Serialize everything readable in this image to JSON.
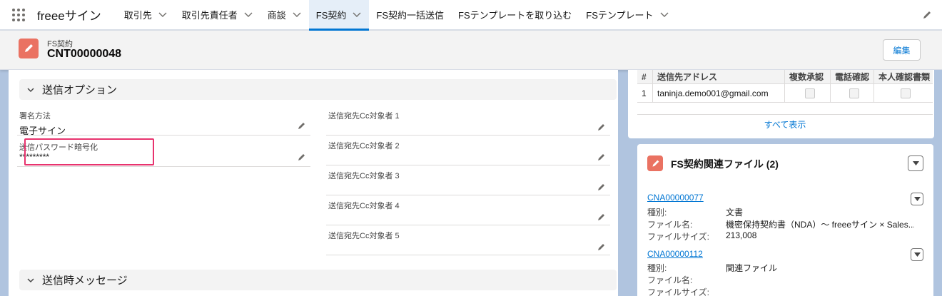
{
  "app": {
    "name": "freeeサイン"
  },
  "nav": {
    "tabs": [
      {
        "label": "取引先",
        "dropdown": true,
        "active": false
      },
      {
        "label": "取引先責任者",
        "dropdown": true,
        "active": false
      },
      {
        "label": "商談",
        "dropdown": true,
        "active": false
      },
      {
        "label": "FS契約",
        "dropdown": true,
        "active": true
      },
      {
        "label": "FS契約一括送信",
        "dropdown": false,
        "active": false
      },
      {
        "label": "FSテンプレートを取り込む",
        "dropdown": false,
        "active": false
      },
      {
        "label": "FSテンプレート",
        "dropdown": true,
        "active": false
      }
    ]
  },
  "record": {
    "type_label": "FS契約",
    "title": "CNT00000048",
    "edit_label": "編集"
  },
  "send_options": {
    "section_title": "送信オプション",
    "left_fields": [
      {
        "label": "署名方法",
        "value": "電子サイン"
      },
      {
        "label": "送信パスワード暗号化",
        "value": "*********"
      }
    ],
    "cc_fields": [
      {
        "label": "送信宛先Cc対象者 1",
        "value": ""
      },
      {
        "label": "送信宛先Cc対象者 2",
        "value": ""
      },
      {
        "label": "送信宛先Cc対象者 3",
        "value": ""
      },
      {
        "label": "送信宛先Cc対象者 4",
        "value": ""
      },
      {
        "label": "送信宛先Cc対象者 5",
        "value": ""
      }
    ]
  },
  "message_section": {
    "section_title": "送信時メッセージ"
  },
  "recipients_table": {
    "headers": [
      "#",
      "送信先アドレス",
      "複数承認",
      "電話確認",
      "本人確認書類"
    ],
    "rows": [
      {
        "num": "1",
        "address": "taninja.demo001@gmail.com",
        "multi_approval": false,
        "phone_check": false,
        "id_document": false
      }
    ],
    "view_all_label": "すべて表示"
  },
  "related_files": {
    "title": "FS契約関連ファイル (2)",
    "items": [
      {
        "name": "CNA00000077",
        "fields": [
          {
            "label": "種別:",
            "value": "文書"
          },
          {
            "label": "ファイル名:",
            "value": "機密保持契約書（NDA）〜 freeeサイン × Sales..."
          },
          {
            "label": "ファイルサイズ:",
            "value": "213,008"
          }
        ]
      },
      {
        "name": "CNA00000112",
        "fields": [
          {
            "label": "種別:",
            "value": "関連ファイル"
          },
          {
            "label": "ファイル名:",
            "value": ""
          },
          {
            "label": "ファイルサイズ:",
            "value": ""
          }
        ]
      }
    ]
  },
  "colors": {
    "brand_blue": "#0176d3",
    "record_icon": "#ea7262",
    "highlight_box": "#e8336e",
    "page_background": "#b0c4df"
  }
}
